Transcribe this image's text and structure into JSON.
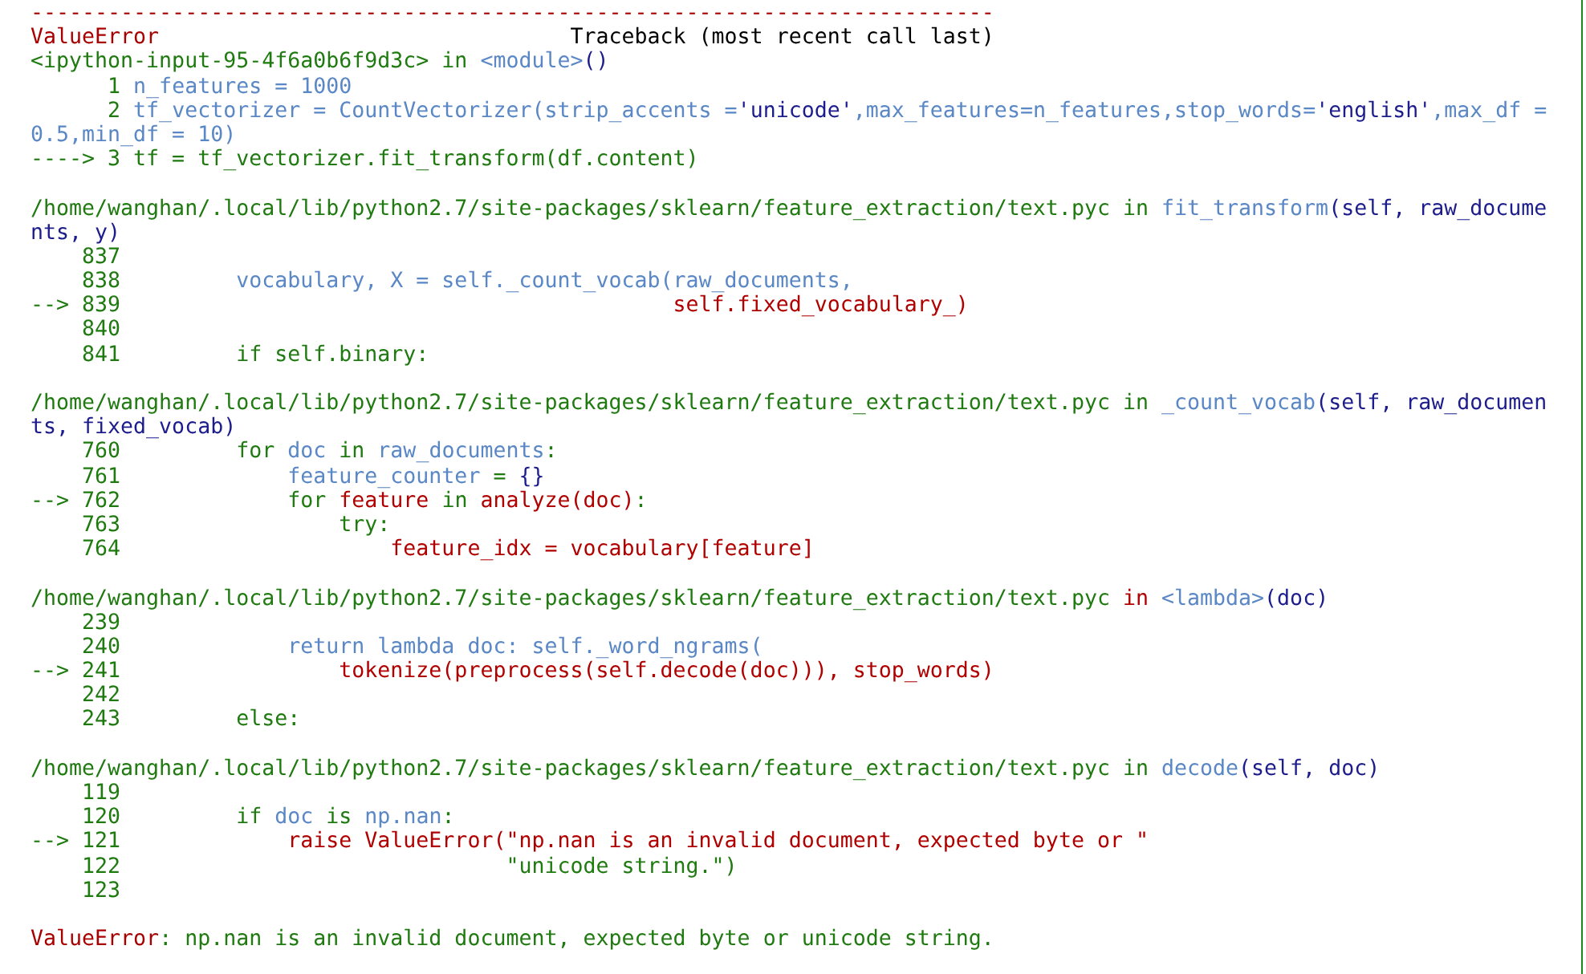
{
  "traceback": [
    {
      "kind": "code",
      "segments": [
        {
          "kind": "error",
          "text": "---------------------------------------------------------------------------"
        }
      ]
    },
    {
      "kind": "code",
      "segments": [
        {
          "kind": "error",
          "text": "ValueError"
        },
        {
          "kind": "head",
          "text": "                                Traceback (most recent call last)"
        }
      ]
    },
    {
      "kind": "code",
      "segments": [
        {
          "kind": "plain",
          "text": "<ipython-input-95-4f6a0b6f9d3c> in "
        },
        {
          "kind": "name",
          "text": "<module>"
        },
        {
          "kind": "args",
          "text": "()"
        }
      ]
    },
    {
      "kind": "code",
      "segments": [
        {
          "kind": "plain",
          "text": "      1 "
        },
        {
          "kind": "name",
          "text": "n_features = 1000"
        }
      ]
    },
    {
      "kind": "code",
      "segments": [
        {
          "kind": "plain",
          "text": "      2 "
        },
        {
          "kind": "name",
          "text": "tf_vectorizer = CountVectorizer(strip_accents ="
        },
        {
          "kind": "args",
          "text": "'unicode'"
        },
        {
          "kind": "name",
          "text": ",max_features=n_features,stop_words="
        },
        {
          "kind": "args",
          "text": "'english'"
        },
        {
          "kind": "name",
          "text": ",max_df ="
        }
      ]
    },
    {
      "kind": "code",
      "segments": [
        {
          "kind": "name",
          "text": "0.5,min_df = 10)"
        }
      ]
    },
    {
      "kind": "code",
      "segments": [
        {
          "kind": "plain",
          "text": "----> 3 tf = tf_vectorizer.fit_transform(df.content)"
        }
      ]
    },
    {
      "kind": "blank"
    },
    {
      "kind": "code",
      "segments": [
        {
          "kind": "plain",
          "text": "/home/wanghan/.local/lib/python2.7/site-packages/sklearn/feature_extraction/text.pyc in "
        },
        {
          "kind": "name",
          "text": "fit_transform"
        },
        {
          "kind": "args",
          "text": "(self, raw_docume"
        }
      ]
    },
    {
      "kind": "code",
      "segments": [
        {
          "kind": "args",
          "text": "nts, y)"
        }
      ]
    },
    {
      "kind": "code",
      "segments": [
        {
          "kind": "plain",
          "text": "    837"
        }
      ]
    },
    {
      "kind": "code",
      "segments": [
        {
          "kind": "plain",
          "text": "    838"
        },
        {
          "kind": "name",
          "text": "         vocabulary, X = self._count_vocab(raw_documents,"
        }
      ]
    },
    {
      "kind": "code",
      "segments": [
        {
          "kind": "plain",
          "text": "--> 839"
        },
        {
          "kind": "hot",
          "text": "                                           self.fixed_vocabulary_)"
        }
      ]
    },
    {
      "kind": "code",
      "segments": [
        {
          "kind": "plain",
          "text": "    840"
        }
      ]
    },
    {
      "kind": "code",
      "segments": [
        {
          "kind": "plain",
          "text": "    841         if self.binary:"
        }
      ]
    },
    {
      "kind": "blank"
    },
    {
      "kind": "code",
      "segments": [
        {
          "kind": "plain",
          "text": "/home/wanghan/.local/lib/python2.7/site-packages/sklearn/feature_extraction/text.pyc in "
        },
        {
          "kind": "name",
          "text": "_count_vocab"
        },
        {
          "kind": "args",
          "text": "(self, raw_documen"
        }
      ]
    },
    {
      "kind": "code",
      "segments": [
        {
          "kind": "args",
          "text": "ts, fixed_vocab)"
        }
      ]
    },
    {
      "kind": "code",
      "segments": [
        {
          "kind": "plain",
          "text": "    760         for "
        },
        {
          "kind": "name",
          "text": "doc"
        },
        {
          "kind": "plain",
          "text": " in "
        },
        {
          "kind": "name",
          "text": "raw_documents"
        },
        {
          "kind": "plain",
          "text": ":"
        }
      ]
    },
    {
      "kind": "code",
      "segments": [
        {
          "kind": "plain",
          "text": "    761"
        },
        {
          "kind": "name",
          "text": "             feature_counter"
        },
        {
          "kind": "plain",
          "text": " = "
        },
        {
          "kind": "args",
          "text": "{}"
        }
      ]
    },
    {
      "kind": "code",
      "segments": [
        {
          "kind": "plain",
          "text": "--> 762             for "
        },
        {
          "kind": "hot",
          "text": "feature"
        },
        {
          "kind": "plain",
          "text": " in "
        },
        {
          "kind": "hot",
          "text": "analyze(doc)"
        },
        {
          "kind": "plain",
          "text": ":"
        }
      ]
    },
    {
      "kind": "code",
      "segments": [
        {
          "kind": "plain",
          "text": "    763                 try:"
        }
      ]
    },
    {
      "kind": "code",
      "segments": [
        {
          "kind": "plain",
          "text": "    764"
        },
        {
          "kind": "hot",
          "text": "                     feature_idx = vocabulary[feature]"
        }
      ]
    },
    {
      "kind": "blank"
    },
    {
      "kind": "code",
      "segments": [
        {
          "kind": "plain",
          "text": "/home/wanghan/.local/lib/python2.7/site-packages/sklearn/feature_extraction/text.pyc "
        },
        {
          "kind": "hot",
          "text": "in "
        },
        {
          "kind": "name",
          "text": "<lambda>"
        },
        {
          "kind": "args",
          "text": "(doc)"
        }
      ]
    },
    {
      "kind": "code",
      "segments": [
        {
          "kind": "plain",
          "text": "    239"
        }
      ]
    },
    {
      "kind": "code",
      "segments": [
        {
          "kind": "plain",
          "text": "    240"
        },
        {
          "kind": "name",
          "text": "             return lambda doc: self._word_ngrams("
        }
      ]
    },
    {
      "kind": "code",
      "segments": [
        {
          "kind": "plain",
          "text": "--> 241"
        },
        {
          "kind": "hot",
          "text": "                 tokenize(preprocess(self.decode(doc))), stop_words)"
        }
      ]
    },
    {
      "kind": "code",
      "segments": [
        {
          "kind": "plain",
          "text": "    242"
        }
      ]
    },
    {
      "kind": "code",
      "segments": [
        {
          "kind": "plain",
          "text": "    243         else:"
        }
      ]
    },
    {
      "kind": "blank"
    },
    {
      "kind": "code",
      "segments": [
        {
          "kind": "plain",
          "text": "/home/wanghan/.local/lib/python2.7/site-packages/sklearn/feature_extraction/text.pyc in "
        },
        {
          "kind": "name",
          "text": "decode"
        },
        {
          "kind": "args",
          "text": "(self, doc)"
        }
      ]
    },
    {
      "kind": "code",
      "segments": [
        {
          "kind": "plain",
          "text": "    119"
        }
      ]
    },
    {
      "kind": "code",
      "segments": [
        {
          "kind": "plain",
          "text": "    120         if "
        },
        {
          "kind": "name",
          "text": "doc"
        },
        {
          "kind": "plain",
          "text": " is "
        },
        {
          "kind": "name",
          "text": "np.nan"
        },
        {
          "kind": "plain",
          "text": ":"
        }
      ]
    },
    {
      "kind": "code",
      "segments": [
        {
          "kind": "plain",
          "text": "--> 121"
        },
        {
          "kind": "hot",
          "text": "             raise ValueError(\"np.nan is an invalid document, expected byte or \""
        }
      ]
    },
    {
      "kind": "code",
      "segments": [
        {
          "kind": "plain",
          "text": "    122                              \"unicode string.\")"
        }
      ]
    },
    {
      "kind": "code",
      "segments": [
        {
          "kind": "plain",
          "text": "    123"
        }
      ]
    },
    {
      "kind": "blank"
    },
    {
      "kind": "code",
      "segments": [
        {
          "kind": "error",
          "text": "ValueError"
        },
        {
          "kind": "plain",
          "text": ": np.nan is an invalid document, expected byte or unicode string."
        }
      ]
    }
  ]
}
